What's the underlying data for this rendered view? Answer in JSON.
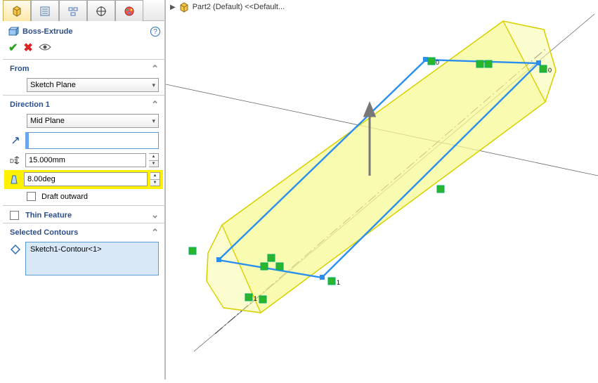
{
  "breadcrumb": {
    "text": "Part2 (Default) <<Default..."
  },
  "feature": {
    "title": "Boss-Extrude"
  },
  "from": {
    "header": "From",
    "end_condition": "Sketch Plane"
  },
  "direction1": {
    "header": "Direction 1",
    "end_condition": "Mid Plane",
    "depth": "15.000mm",
    "draft_angle": "8.00deg",
    "draft_outward_label": "Draft outward"
  },
  "thin": {
    "label": "Thin Feature"
  },
  "contours": {
    "header": "Selected Contours",
    "item": "Sketch1-Contour<1>"
  }
}
